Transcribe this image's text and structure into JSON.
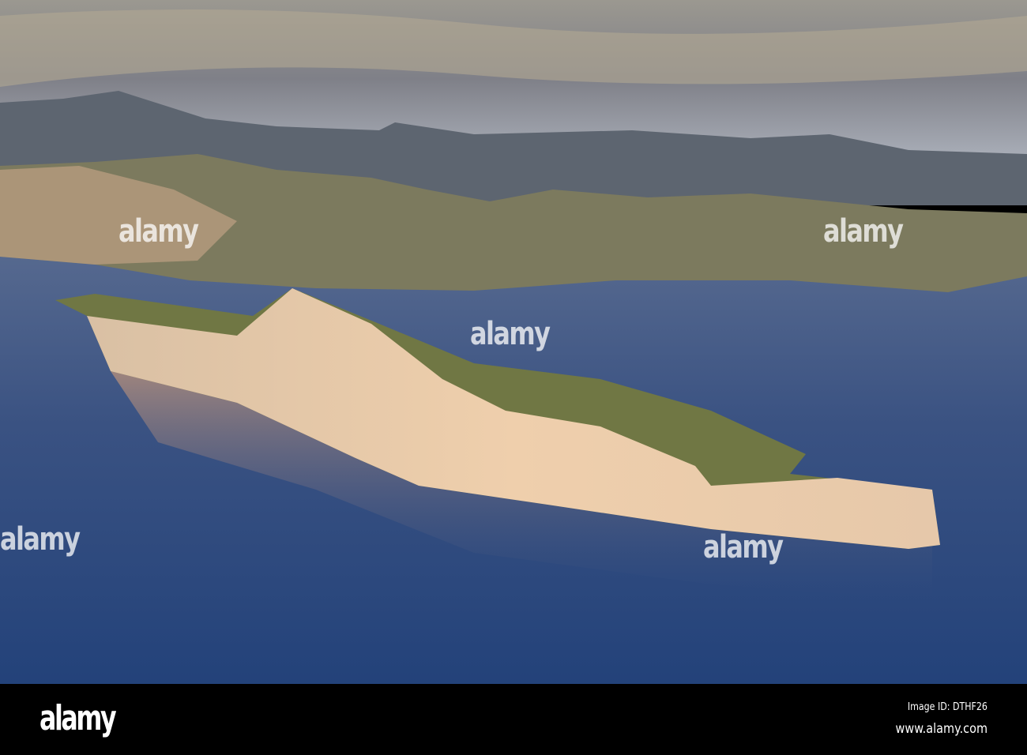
{
  "image": {
    "description_icon": "aerial-photo",
    "colors": {
      "sky": "#8a8a8c",
      "sea": "#2e4a78",
      "cliff": "#e8c9a6",
      "vegetation": "#6f7a48"
    }
  },
  "watermark": {
    "text": "alamy"
  },
  "footer": {
    "logo": "alamy",
    "image_id": "Image ID: DTHF26",
    "url": "www.alamy.com"
  }
}
